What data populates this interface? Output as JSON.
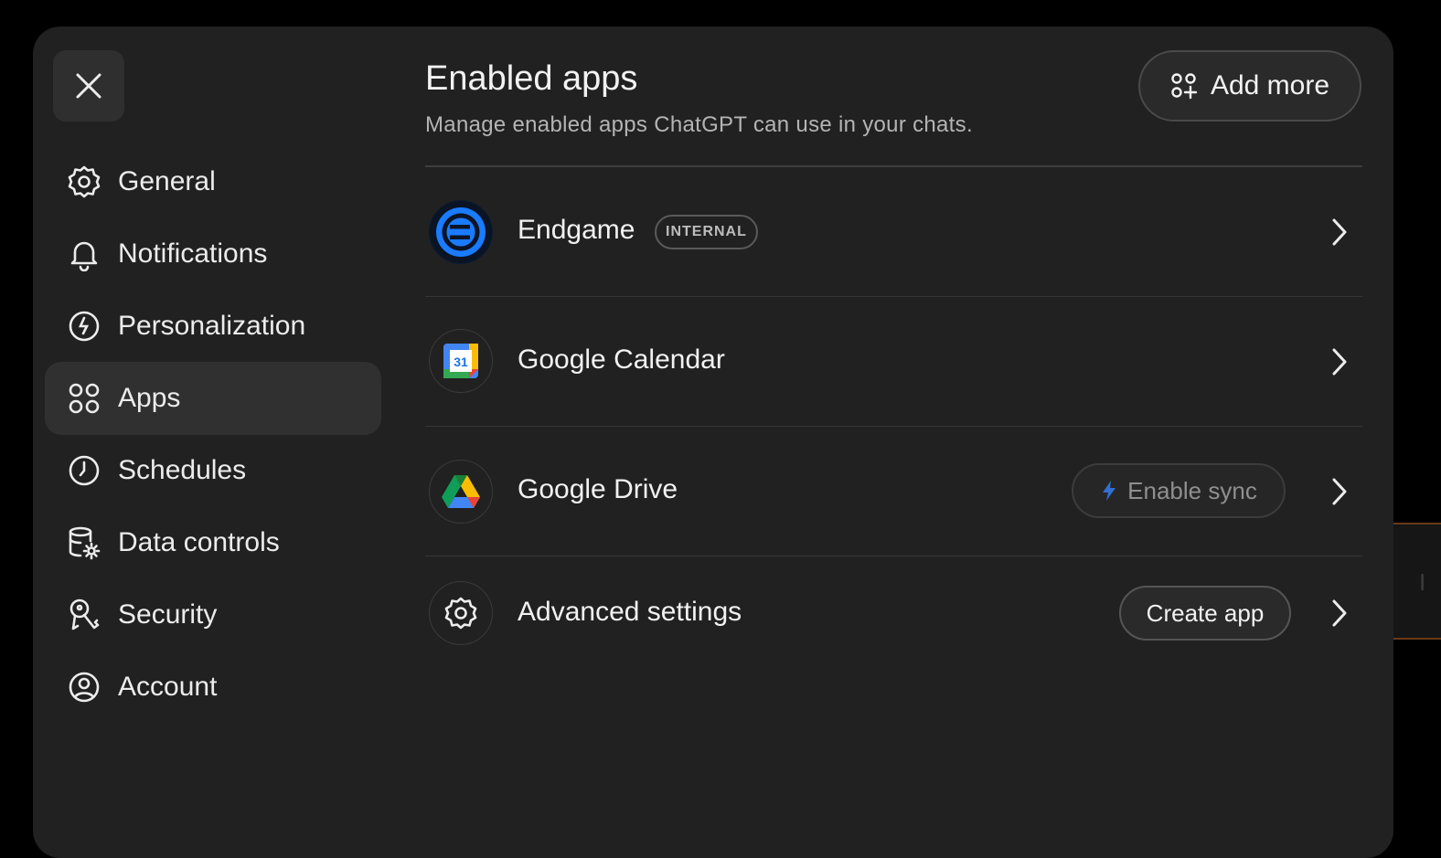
{
  "sidebar": {
    "close_icon": "close-icon",
    "items": [
      {
        "label": "General",
        "icon": "gear-icon"
      },
      {
        "label": "Notifications",
        "icon": "bell-icon"
      },
      {
        "label": "Personalization",
        "icon": "personalization-icon"
      },
      {
        "label": "Apps",
        "icon": "apps-grid-icon",
        "active": true
      },
      {
        "label": "Schedules",
        "icon": "clock-icon"
      },
      {
        "label": "Data controls",
        "icon": "database-gear-icon"
      },
      {
        "label": "Security",
        "icon": "key-icon"
      },
      {
        "label": "Account",
        "icon": "user-circle-icon"
      }
    ]
  },
  "main": {
    "title": "Enabled apps",
    "subtitle": "Manage enabled apps ChatGPT can use in your chats.",
    "add_more_label": "Add more",
    "apps": [
      {
        "name": "Endgame",
        "badge": "INTERNAL",
        "icon": "endgame-logo-icon"
      },
      {
        "name": "Google Calendar",
        "icon": "google-calendar-icon",
        "logo_text": "31"
      },
      {
        "name": "Google Drive",
        "icon": "google-drive-icon",
        "action_label": "Enable sync"
      },
      {
        "name": "Advanced settings",
        "icon": "gear-icon",
        "action_label": "Create app"
      }
    ]
  },
  "colors": {
    "background": "#000000",
    "panel": "#212121",
    "active_item": "#303030",
    "endgame_blue": "#1a7bff",
    "sync_bolt": "#2f6fd6"
  }
}
